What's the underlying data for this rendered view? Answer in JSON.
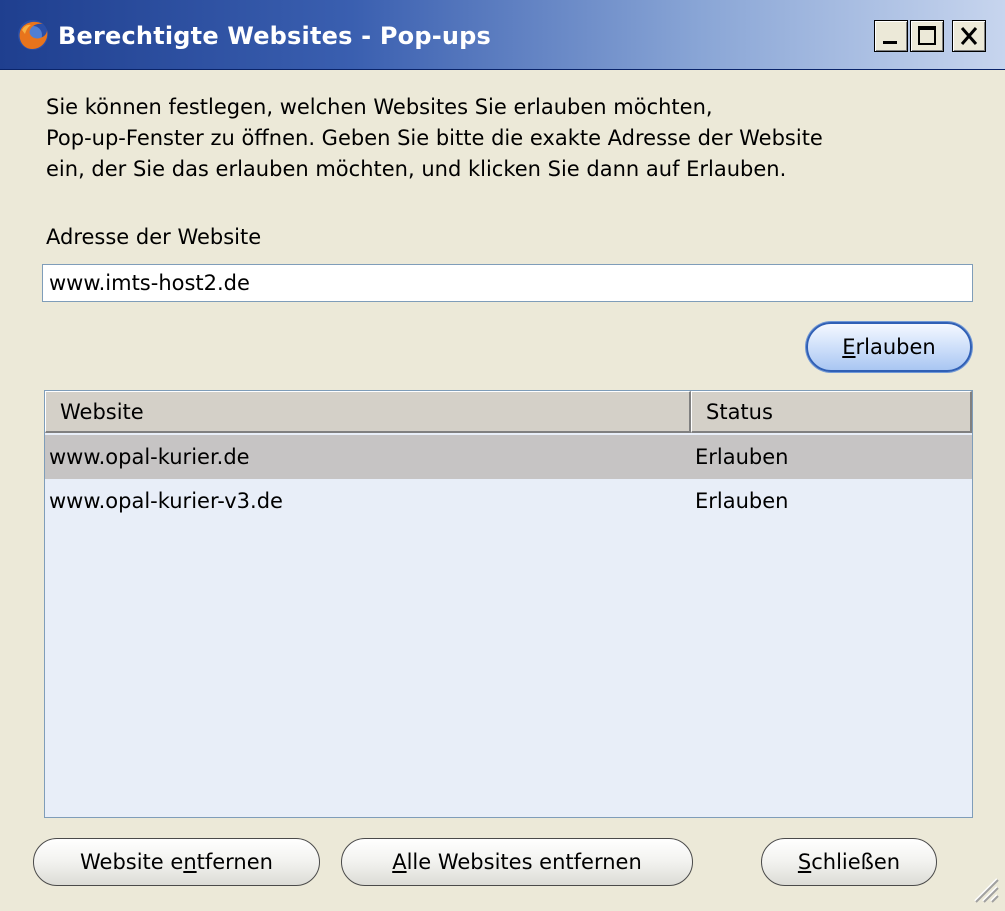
{
  "window": {
    "title": "Berechtigte Websites - Pop-ups",
    "icon": "firefox-icon"
  },
  "description": {
    "lines": [
      "Sie können festlegen, welchen Websites Sie erlauben möchten,",
      "Pop-up-Fenster zu öffnen. Geben Sie bitte die exakte Adresse der Website",
      "ein, der Sie das erlauben möchten, und klicken Sie dann auf Erlauben."
    ]
  },
  "address": {
    "label": "Adresse der Website",
    "value": "www.imts-host2.de"
  },
  "allow_button": {
    "accesskey": "E",
    "rest": "rlauben"
  },
  "table": {
    "columns": [
      "Website",
      "Status"
    ],
    "rows": [
      {
        "site": "www.opal-kurier.de",
        "status": "Erlauben",
        "selected": true
      },
      {
        "site": "www.opal-kurier-v3.de",
        "status": "Erlauben",
        "selected": false
      }
    ]
  },
  "footer": {
    "remove": {
      "pre": "Website e",
      "key": "n",
      "post": "tfernen"
    },
    "remove_all": {
      "pre": "",
      "key": "A",
      "post": "lle Websites entfernen"
    },
    "close": {
      "pre": "",
      "key": "S",
      "post": "chließen"
    }
  },
  "colors": {
    "titlebar_start": "#1f3f8f",
    "titlebar_end": "#c7d5ee",
    "dialog_bg": "#ece9d8",
    "list_bg": "#e8eef8",
    "selected_row": "#c6c4c4",
    "default_button_border": "#2f5fb5"
  }
}
